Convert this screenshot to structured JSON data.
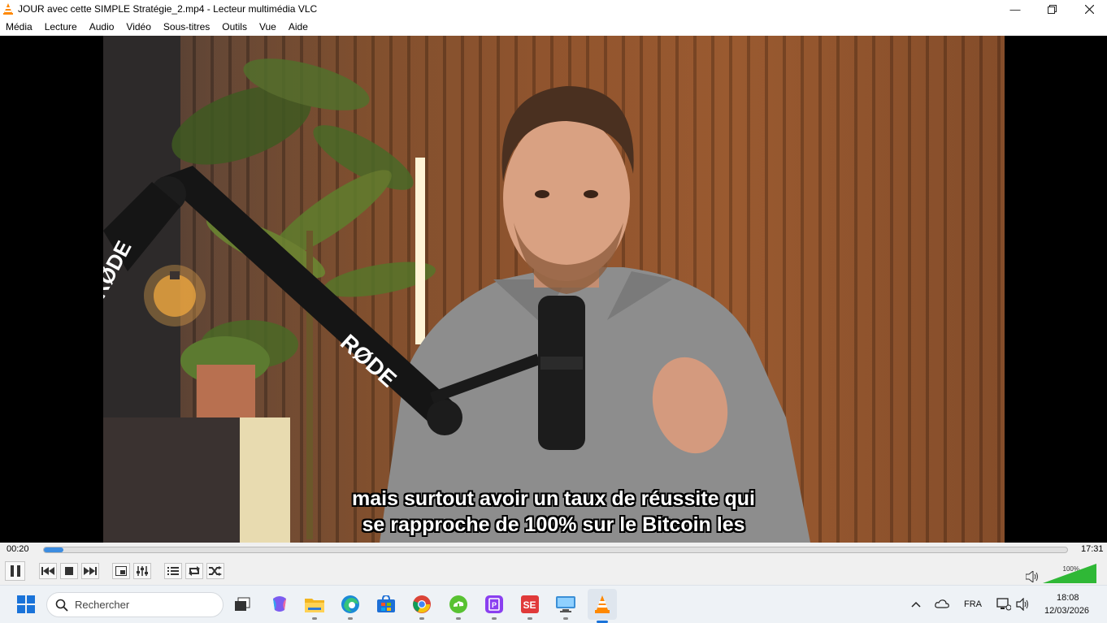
{
  "window": {
    "title": "JOUR avec cette SIMPLE Stratégie_2.mp4 - Lecteur multimédia VLC",
    "controls": [
      "minimize-icon",
      "maximize-icon",
      "close-icon"
    ]
  },
  "menu": {
    "items": [
      "Média",
      "Lecture",
      "Audio",
      "Vidéo",
      "Sous-titres",
      "Outils",
      "Vue",
      "Aide"
    ]
  },
  "video": {
    "subtitle_line1": "mais surtout avoir un taux de réussite qui",
    "subtitle_line2": "se rapproche de 100% sur le Bitcoin les",
    "mic_brand": "RØDE"
  },
  "player": {
    "elapsed": "00:20",
    "total": "17:31",
    "progress_fraction": 0.019,
    "volume_label": "100%",
    "volume_fraction": 1.0,
    "buttons": [
      "pause-icon",
      "previous-icon",
      "stop-icon",
      "next-icon",
      "fullscreen-icon",
      "extended-settings-icon",
      "playlist-icon",
      "loop-icon",
      "shuffle-icon",
      "speaker-icon"
    ]
  },
  "taskbar": {
    "search_placeholder": "Rechercher",
    "apps": [
      "windows-start-icon",
      "task-view-icon",
      "copilot-icon",
      "file-explorer-icon",
      "edge-icon",
      "store-icon",
      "chrome-icon",
      "cloud-app-icon",
      "purple-app-icon",
      "red-app-icon",
      "remote-desktop-icon",
      "vlc-icon"
    ],
    "language": "FRA",
    "clock_time": "18:08",
    "clock_date": "12/03/2026"
  },
  "colors": {
    "seek_fill": "#3c8ce0",
    "volume_fill": "#2fb836",
    "vlc_orange": "#ff8800"
  }
}
